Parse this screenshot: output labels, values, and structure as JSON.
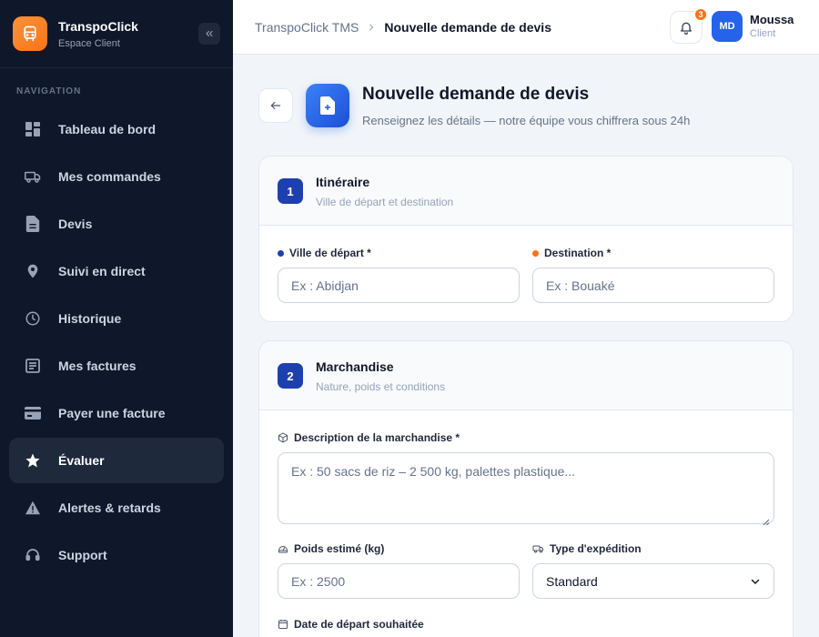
{
  "brand": {
    "name": "TranspoClick",
    "subtitle": "Espace Client"
  },
  "nav": {
    "section_label": "NAVIGATION",
    "items": [
      {
        "label": "Tableau de bord",
        "icon": "dashboard-icon"
      },
      {
        "label": "Mes commandes",
        "icon": "truck-icon"
      },
      {
        "label": "Devis",
        "icon": "document-icon"
      },
      {
        "label": "Suivi en direct",
        "icon": "map-pin-icon"
      },
      {
        "label": "Historique",
        "icon": "clock-icon"
      },
      {
        "label": "Mes factures",
        "icon": "invoice-icon"
      },
      {
        "label": "Payer une facture",
        "icon": "credit-card-icon"
      },
      {
        "label": "Évaluer",
        "icon": "star-icon",
        "active": true
      },
      {
        "label": "Alertes & retards",
        "icon": "warning-icon"
      },
      {
        "label": "Support",
        "icon": "headset-icon"
      }
    ]
  },
  "topbar": {
    "breadcrumb_root": "TranspoClick TMS",
    "breadcrumb_current": "Nouvelle demande de devis",
    "notifications_count": "3",
    "user_initials": "MD",
    "user_name": "Moussa",
    "user_role": "Client"
  },
  "page": {
    "title": "Nouvelle demande de devis",
    "subtitle": "Renseignez les détails — notre équipe vous chiffrera sous 24h"
  },
  "itinerary": {
    "step": "1",
    "title": "Itinéraire",
    "subtitle": "Ville de départ et destination",
    "departure_label": "Ville de départ *",
    "departure_placeholder": "Ex : Abidjan",
    "destination_label": "Destination *",
    "destination_placeholder": "Ex : Bouaké"
  },
  "goods": {
    "step": "2",
    "title": "Marchandise",
    "subtitle": "Nature, poids et conditions",
    "description_label": "Description de la marchandise *",
    "description_placeholder": "Ex : 50 sacs de riz – 2 500 kg, palettes plastique...",
    "weight_label": "Poids estimé (kg)",
    "weight_placeholder": "Ex : 2500",
    "shipping_type_label": "Type d'expédition",
    "shipping_type_value": "Standard",
    "date_label": "Date de départ souhaitée"
  },
  "colors": {
    "accent": "#1e40af",
    "brand_orange": "#f97316",
    "departure_dot": "#1e40af",
    "destination_dot": "#f97316",
    "sidebar_bg": "#0f172a"
  }
}
